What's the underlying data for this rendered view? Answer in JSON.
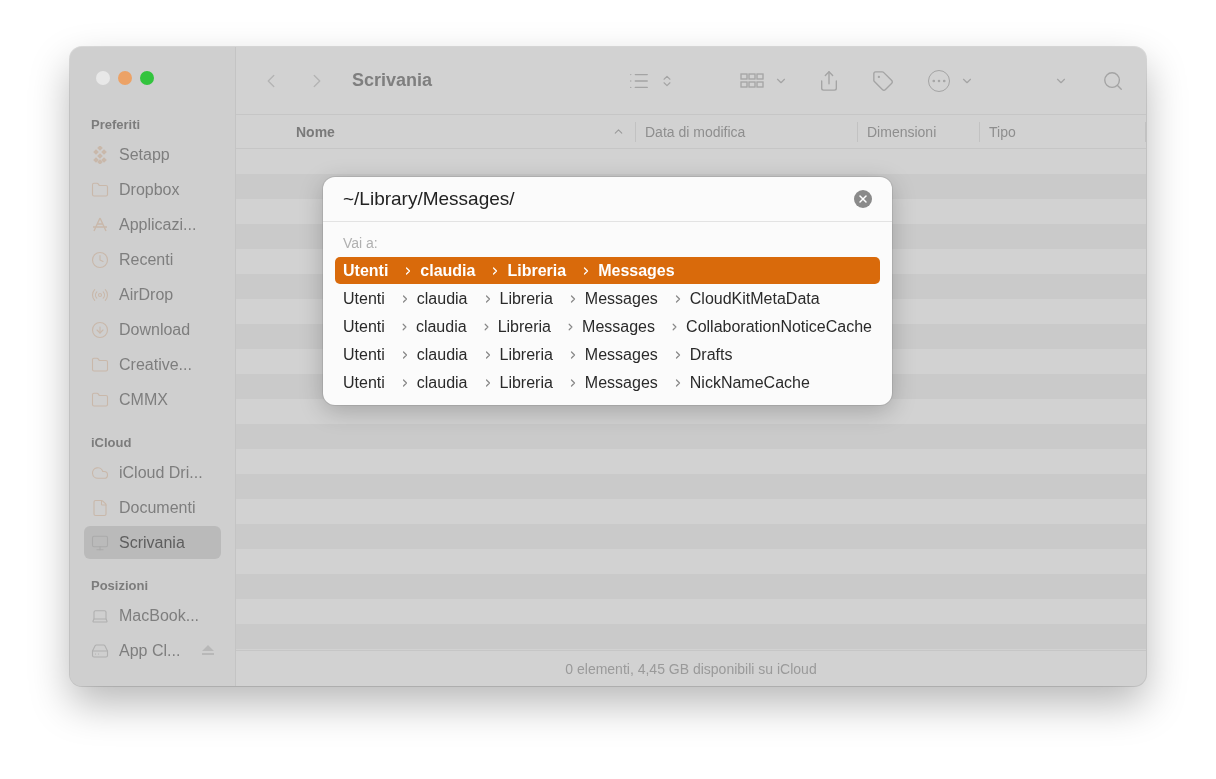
{
  "window": {
    "title": "Scrivania"
  },
  "sidebar": {
    "sections": [
      {
        "heading": "Preferiti",
        "items": [
          {
            "label": "Setapp",
            "selected": false
          },
          {
            "label": "Dropbox",
            "selected": false
          },
          {
            "label": "Applicazi...",
            "selected": false
          },
          {
            "label": "Recenti",
            "selected": false
          },
          {
            "label": "AirDrop",
            "selected": false
          },
          {
            "label": "Download",
            "selected": false
          },
          {
            "label": "Creative...",
            "selected": false
          },
          {
            "label": "CMMX",
            "selected": false
          }
        ]
      },
      {
        "heading": "iCloud",
        "items": [
          {
            "label": "iCloud Dri...",
            "selected": false
          },
          {
            "label": "Documenti",
            "selected": false
          },
          {
            "label": "Scrivania",
            "selected": true
          }
        ]
      },
      {
        "heading": "Posizioni",
        "items": [
          {
            "label": "MacBook...",
            "selected": false
          },
          {
            "label": "App Cl...",
            "selected": false
          }
        ]
      }
    ]
  },
  "table": {
    "columns": [
      {
        "label": "Nome",
        "sorted": true
      },
      {
        "label": "Data di modifica",
        "sorted": false
      },
      {
        "label": "Dimensioni",
        "sorted": false
      },
      {
        "label": "Tipo",
        "sorted": false
      }
    ]
  },
  "status_bar": "0 elementi, 4,45 GB disponibili su iCloud",
  "go_to_dialog": {
    "path": "~/Library/Messages/",
    "label": "Vai a:",
    "suggestions": [
      {
        "segments": [
          "Utenti",
          "claudia",
          "Libreria",
          "Messages"
        ],
        "selected": true
      },
      {
        "segments": [
          "Utenti",
          "claudia",
          "Libreria",
          "Messages",
          "CloudKitMetaData"
        ],
        "selected": false
      },
      {
        "segments": [
          "Utenti",
          "claudia",
          "Libreria",
          "Messages",
          "CollaborationNoticeCache"
        ],
        "selected": false
      },
      {
        "segments": [
          "Utenti",
          "claudia",
          "Libreria",
          "Messages",
          "Drafts"
        ],
        "selected": false
      },
      {
        "segments": [
          "Utenti",
          "claudia",
          "Libreria",
          "Messages",
          "NickNameCache"
        ],
        "selected": false
      }
    ]
  }
}
